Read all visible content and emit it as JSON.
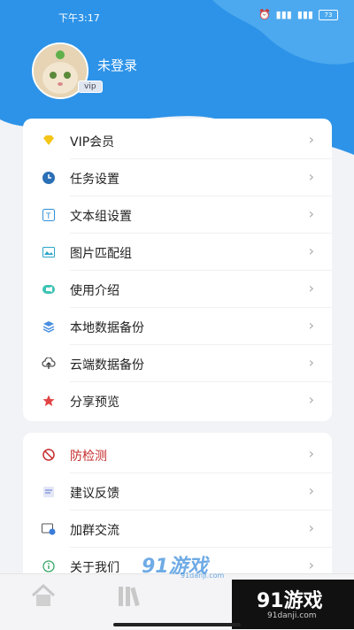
{
  "status": {
    "time": "下午3:17",
    "battery": "73"
  },
  "profile": {
    "username": "未登录",
    "vip_badge": "vip"
  },
  "menu1": [
    {
      "label": "VIP会员",
      "icon": "heart-diamond-icon",
      "color": "#f5c518"
    },
    {
      "label": "任务设置",
      "icon": "clock-icon",
      "color": "#2b6fb6"
    },
    {
      "label": "文本组设置",
      "icon": "text-box-icon",
      "color": "#2f8fd8"
    },
    {
      "label": "图片匹配组",
      "icon": "image-icon",
      "color": "#2ba5c9"
    },
    {
      "label": "使用介绍",
      "icon": "video-icon",
      "color": "#3cc3b5"
    },
    {
      "label": "本地数据备份",
      "icon": "layers-icon",
      "color": "#4a8fe0"
    },
    {
      "label": "云端数据备份",
      "icon": "cloud-upload-icon",
      "color": "#555"
    },
    {
      "label": "分享预览",
      "icon": "star-icon",
      "color": "#e14444"
    }
  ],
  "menu2": [
    {
      "label": "防检测",
      "icon": "block-icon",
      "color": "#c62c2c"
    },
    {
      "label": "建议反馈",
      "icon": "feedback-icon",
      "color": "#7a8bd6"
    },
    {
      "label": "加群交流",
      "icon": "group-icon",
      "color": "#3b7bd9"
    },
    {
      "label": "关于我们",
      "icon": "info-icon",
      "color": "#3aa96b"
    }
  ],
  "watermark": {
    "main": "91游戏",
    "sub": "91danji.com"
  },
  "colors": {
    "header": "#2d93e8",
    "header_light": "#5ab2f2",
    "accent_red": "#c62c2c"
  }
}
